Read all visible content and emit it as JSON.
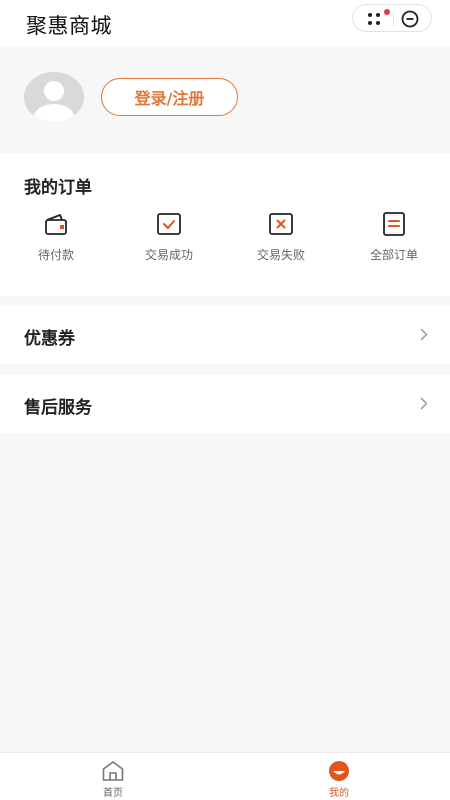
{
  "header": {
    "app_title": "聚惠商城",
    "capsule": {
      "more_icon": "more-dots-icon",
      "close_icon": "close-circle-icon",
      "notification_color": "#e53935"
    }
  },
  "profile": {
    "avatar_icon": "default-avatar-icon",
    "login_label": "登录/注册"
  },
  "orders": {
    "title": "我的订单",
    "items": [
      {
        "label": "待付款",
        "icon": "wallet-icon"
      },
      {
        "label": "交易成功",
        "icon": "check-box-icon"
      },
      {
        "label": "交易失败",
        "icon": "x-box-icon"
      },
      {
        "label": "全部订单",
        "icon": "list-icon"
      }
    ]
  },
  "menu": [
    {
      "label": "优惠券",
      "icon": "chevron-right-icon"
    },
    {
      "label": "售后服务",
      "icon": "chevron-right-icon"
    }
  ],
  "tabbar": [
    {
      "label": "首页",
      "icon": "home-icon",
      "active": false
    },
    {
      "label": "我的",
      "icon": "mine-icon",
      "active": true
    }
  ],
  "colors": {
    "accent": "#e0783a",
    "active_tab": "#e4541c",
    "inactive_tab": "#666666",
    "page_bg": "#f7f7f7"
  }
}
